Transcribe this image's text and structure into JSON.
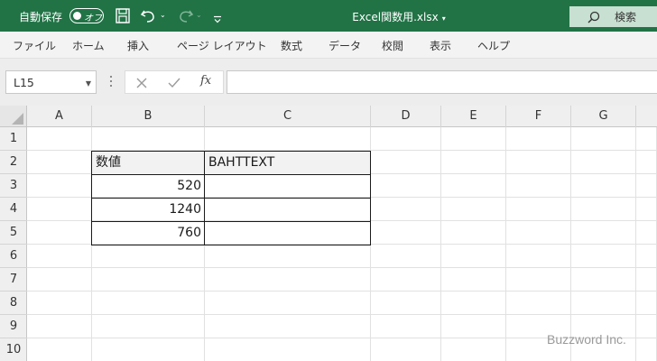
{
  "titlebar": {
    "autosave_label": "自動保存",
    "autosave_state": "オフ",
    "filename": "Excel関数用.xlsx",
    "filename_caret": "▾",
    "search_label": "検索",
    "bg_color": "#217346",
    "icons": [
      "save-icon",
      "undo-icon",
      "redo-icon",
      "customize-qat-icon",
      "search-icon"
    ]
  },
  "ribbon": {
    "tabs": [
      "ファイル",
      "ホーム",
      "挿入",
      "ページ レイアウト",
      "数式",
      "データ",
      "校閲",
      "表示",
      "ヘルプ"
    ]
  },
  "formula_bar": {
    "name_box": "L15",
    "formula": "",
    "icons": [
      "cancel-icon",
      "enter-icon",
      "fx-icon"
    ]
  },
  "grid": {
    "columns": [
      "A",
      "B",
      "C",
      "D",
      "E",
      "F",
      "G"
    ],
    "rows": [
      "1",
      "2",
      "3",
      "4",
      "5",
      "6",
      "7",
      "8",
      "9",
      "10"
    ],
    "table": {
      "headers": [
        "数値",
        "BAHTTEXT"
      ],
      "rows": [
        [
          "520",
          ""
        ],
        [
          "1240",
          ""
        ],
        [
          "760",
          ""
        ]
      ]
    }
  },
  "watermark": "Buzzword Inc."
}
